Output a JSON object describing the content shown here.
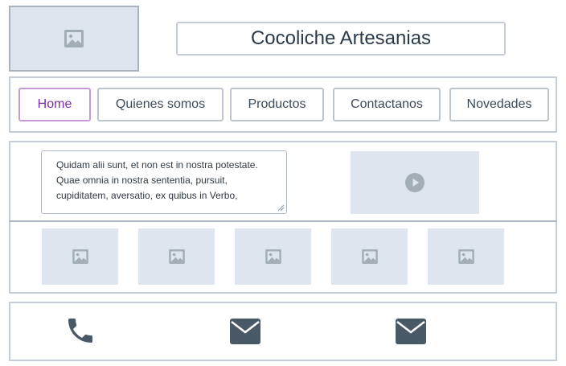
{
  "header": {
    "title": "Cocoliche Artesanias",
    "logo_icon": "image-icon"
  },
  "nav": {
    "items": [
      {
        "label": "Home",
        "active": true
      },
      {
        "label": "Quienes somos",
        "active": false
      },
      {
        "label": "Productos",
        "active": false
      },
      {
        "label": "Contactanos",
        "active": false
      },
      {
        "label": "Novedades",
        "active": false
      }
    ],
    "active_color": "#7b2fa8"
  },
  "content": {
    "paragraph": "Quidam alii sunt, et non est in nostra potestate. Quae omnia in nostra sententia, pursuit, cupiditatem, aversatio, ex quibus in Verbo,",
    "video_icon": "play-icon",
    "gallery_icons": [
      "image-icon",
      "image-icon",
      "image-icon",
      "image-icon",
      "image-icon"
    ]
  },
  "footer": {
    "icons": [
      "phone-icon",
      "mail-icon",
      "mail-icon"
    ]
  },
  "colors": {
    "placeholder_bg": "#dfe5ee",
    "icon_gray": "#a3adb8",
    "icon_dark": "#4a5968",
    "border": "#c5cdd6"
  }
}
